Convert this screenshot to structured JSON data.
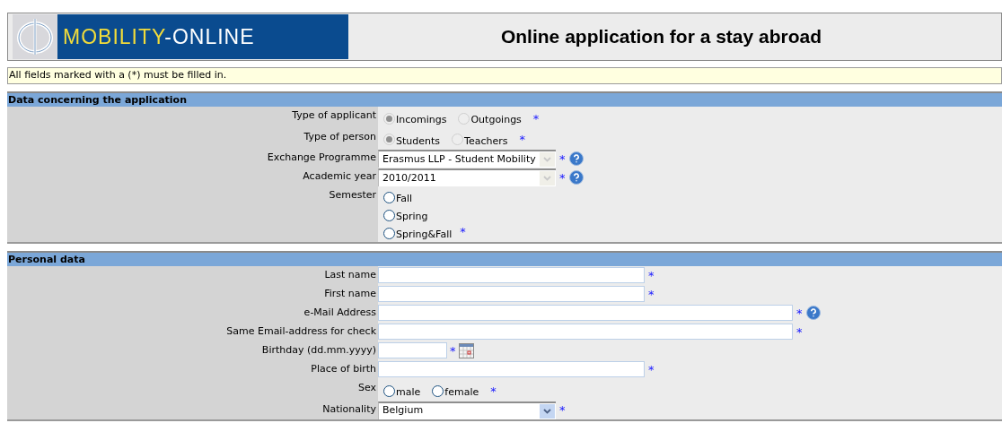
{
  "header": {
    "logo": {
      "part_1": "MOBILITY",
      "part_2": "-ONLINE"
    },
    "title": "Online application for a stay abroad"
  },
  "notice": "All fields marked with a (*) must be filled in.",
  "sections": [
    {
      "title": "Data concerning the application",
      "fields": [
        {
          "kind": "radio",
          "label": "Type of applicant",
          "required": "*",
          "help": false,
          "options": [
            {
              "label": "Incomings",
              "selected": true,
              "disabled": true
            },
            {
              "label": "Outgoings",
              "selected": false,
              "disabled": true
            }
          ]
        },
        {
          "kind": "radio",
          "label": "Type of person",
          "required": "*",
          "help": false,
          "options": [
            {
              "label": "Students",
              "selected": true,
              "disabled": true
            },
            {
              "label": "Teachers",
              "selected": false,
              "disabled": true
            }
          ]
        },
        {
          "kind": "select",
          "label": "Exchange Programme",
          "required": "*",
          "help": true,
          "value": "Erasmus LLP - Student Mobility",
          "disabled": true
        },
        {
          "kind": "select",
          "label": "Academic year",
          "required": "*",
          "help": true,
          "value": "2010/2011",
          "disabled": true
        },
        {
          "kind": "radio-list",
          "label": "Semester",
          "required": "*",
          "help": false,
          "options": [
            {
              "label": "Fall",
              "selected": false,
              "disabled": false
            },
            {
              "label": "Spring",
              "selected": false,
              "disabled": false
            },
            {
              "label": "Spring&Fall",
              "selected": false,
              "disabled": false
            }
          ]
        }
      ]
    },
    {
      "title": "Personal data",
      "fields": [
        {
          "kind": "text",
          "label": "Last name",
          "required": "*",
          "help": false
        },
        {
          "kind": "text",
          "label": "First name",
          "required": "*",
          "help": false
        },
        {
          "kind": "wide-text",
          "label": "e-Mail Address",
          "required": "*",
          "help": true
        },
        {
          "kind": "wide-text",
          "label": "Same Email-address for check",
          "required": "*",
          "help": false
        },
        {
          "kind": "date",
          "label": "Birthday (dd.mm.yyyy)",
          "required": "*",
          "help": false
        },
        {
          "kind": "text",
          "label": "Place of birth",
          "required": "*",
          "help": false
        },
        {
          "kind": "radio",
          "label": "Sex",
          "required": "*",
          "help": false,
          "options": [
            {
              "label": "male",
              "selected": false,
              "disabled": false
            },
            {
              "label": "female",
              "selected": false,
              "disabled": false
            }
          ]
        },
        {
          "kind": "select",
          "label": "Nationality",
          "required": "*",
          "help": false,
          "value": "Belgium",
          "disabled": false
        }
      ]
    }
  ]
}
